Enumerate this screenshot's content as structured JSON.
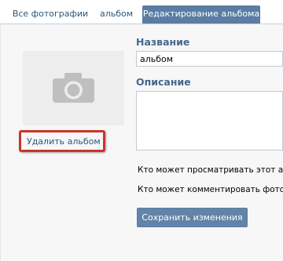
{
  "tabs": [
    {
      "label": "Все фотографии"
    },
    {
      "label": "альбом"
    },
    {
      "label": "Редактирование альбома",
      "active": true
    }
  ],
  "cover": {
    "icon": "camera-icon",
    "delete_label": "Удалить альбом"
  },
  "form": {
    "name_label": "Название",
    "name_value": "альбом",
    "description_label": "Описание",
    "description_value": "",
    "privacy_view": "Кто может просматривать этот альбом",
    "privacy_comment": "Кто может комментировать фотографии",
    "save_label": "Сохранить изменения"
  },
  "colors": {
    "accent": "#597da3",
    "link": "#2b587a",
    "highlight_border": "#c8362a"
  }
}
